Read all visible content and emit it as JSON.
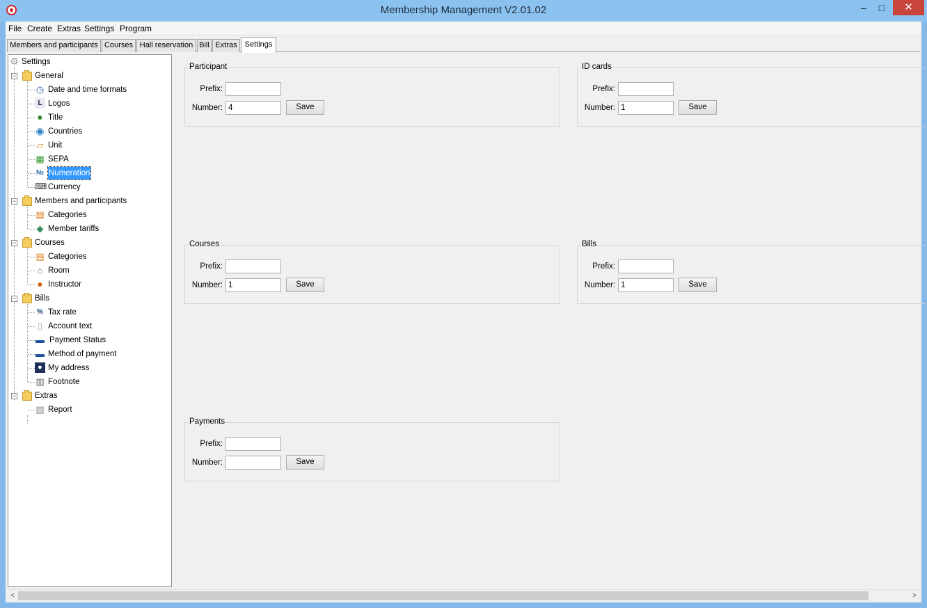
{
  "window": {
    "title": "Membership Management V2.01.02",
    "minimize": "–",
    "maximize": "□",
    "close": "✕"
  },
  "menu": [
    "File",
    "Create",
    "Extras",
    "Settings",
    "Program"
  ],
  "tabs": [
    "Members and participants",
    "Courses",
    "Hall reservation",
    "Bill",
    "Extras",
    "Settings"
  ],
  "active_tab": "Settings",
  "tree": {
    "root": "Settings",
    "general": {
      "label": "General",
      "items": [
        "Date and time formats",
        "Logos",
        "Title",
        "Countries",
        "Unit",
        "SEPA",
        "Numeration",
        "Currency"
      ]
    },
    "members": {
      "label": "Members and participants",
      "items": [
        "Categories",
        "Member tariffs"
      ]
    },
    "courses": {
      "label": "Courses",
      "items": [
        "Categories",
        "Room",
        "Instructor"
      ]
    },
    "bills": {
      "label": "Bills",
      "items": [
        "Tax rate",
        "Account text",
        "Payment Status",
        "Method of payment",
        "My address",
        "Footnote"
      ]
    },
    "extras": {
      "label": "Extras",
      "items": [
        "Report"
      ]
    },
    "selected": "Numeration"
  },
  "groups": {
    "participant": {
      "title": "Participant",
      "prefix_label": "Prefix:",
      "number_label": "Number:",
      "prefix": "",
      "number": "4",
      "save": "Save"
    },
    "id_cards": {
      "title": "ID cards",
      "prefix_label": "Prefix:",
      "number_label": "Number:",
      "prefix": "",
      "number": "1",
      "save": "Save"
    },
    "courses": {
      "title": "Courses",
      "prefix_label": "Prefix:",
      "number_label": "Number:",
      "prefix": "",
      "number": "1",
      "save": "Save"
    },
    "bills": {
      "title": "Bills",
      "prefix_label": "Prefix:",
      "number_label": "Number:",
      "prefix": "",
      "number": "1",
      "save": "Save"
    },
    "payments": {
      "title": "Payments",
      "prefix_label": "Prefix:",
      "number_label": "Number:",
      "prefix": "",
      "number": "",
      "save": "Save"
    }
  },
  "scrollbar": {
    "left": "<",
    "right": ">"
  }
}
